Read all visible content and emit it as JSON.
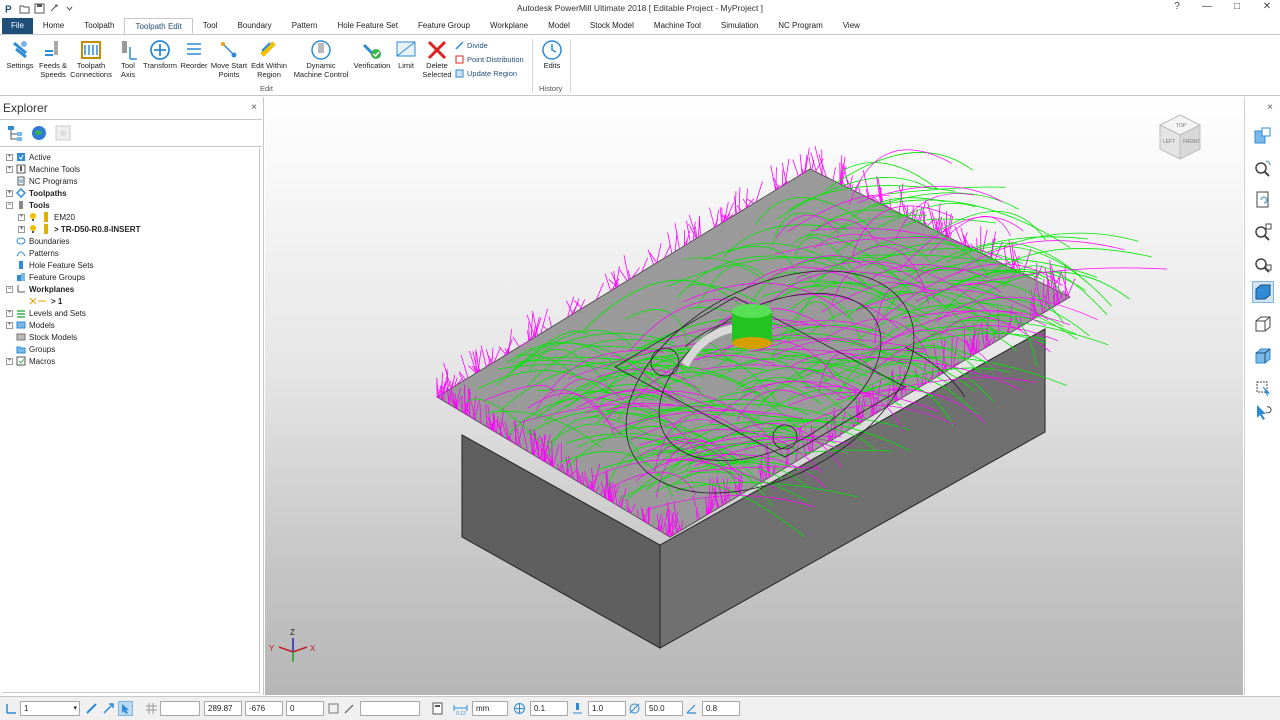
{
  "window": {
    "title": "Autodesk PowerMill Ultimate 2018   [ Editable Project - MyProject ]",
    "help": "?",
    "minimize": "—",
    "maximize": "□",
    "close": "✕"
  },
  "tabs": [
    {
      "label": "File"
    },
    {
      "label": "Home"
    },
    {
      "label": "Toolpath"
    },
    {
      "label": "Toolpath Edit"
    },
    {
      "label": "Tool"
    },
    {
      "label": "Boundary"
    },
    {
      "label": "Pattern"
    },
    {
      "label": "Hole Feature Set"
    },
    {
      "label": "Feature Group"
    },
    {
      "label": "Workplane"
    },
    {
      "label": "Model"
    },
    {
      "label": "Stock Model"
    },
    {
      "label": "Machine Tool"
    },
    {
      "label": "Simulation"
    },
    {
      "label": "NC Program"
    },
    {
      "label": "View"
    }
  ],
  "ribbon": {
    "settings": "Settings",
    "feeds": "Feeds &\nSpeeds",
    "connections": "Toolpath\nConnections",
    "tool_axis": "Tool\nAxis",
    "transform": "Transform",
    "reorder": "Reorder",
    "move_start": "Move Start\nPoints",
    "edit_within": "Edit Within\nRegion",
    "dynamic": "Dynamic\nMachine Control",
    "verification": "Verification",
    "limit": "Limit",
    "delete_selected": "Delete\nSelected",
    "divide": "Divide",
    "point_distribution": "Point Distribution",
    "update_region": "Update Region",
    "edits": "Edits",
    "group_edit": "Edit",
    "group_history": "History"
  },
  "explorer": {
    "title": "Explorer",
    "close": "×",
    "items": [
      {
        "label": "Active",
        "bold": false
      },
      {
        "label": "Machine Tools",
        "bold": false
      },
      {
        "label": "NC Programs",
        "bold": false
      },
      {
        "label": "Toolpaths",
        "bold": true
      },
      {
        "label": "Tools",
        "bold": true
      },
      {
        "label": "EM20",
        "bold": false
      },
      {
        "label": "> TR-D50-R0.8-INSERT",
        "bold": true
      },
      {
        "label": "Boundaries",
        "bold": false
      },
      {
        "label": "Patterns",
        "bold": false
      },
      {
        "label": "Hole Feature Sets",
        "bold": false
      },
      {
        "label": "Feature Groups",
        "bold": false
      },
      {
        "label": "Workplanes",
        "bold": true
      },
      {
        "label": "> 1",
        "bold": true
      },
      {
        "label": "Levels and Sets",
        "bold": false
      },
      {
        "label": "Models",
        "bold": false
      },
      {
        "label": "Stock Models",
        "bold": false
      },
      {
        "label": "Groups",
        "bold": false
      },
      {
        "label": "Macros",
        "bold": false
      }
    ]
  },
  "viewcube": {
    "top": "TOP",
    "left": "LEFT",
    "front": "FRONT"
  },
  "axes": {
    "x": "X",
    "y": "Y",
    "z": "Z"
  },
  "status": {
    "workplane": "1",
    "x": "289.87",
    "y": "-676",
    "z": "0",
    "units": "mm",
    "tolerance": "0.1",
    "stepover": "1.0",
    "diameter": "50.0",
    "angle": "0.8"
  },
  "colors": {
    "accent": "#1f4e79",
    "toolpath_green": "#00e600",
    "toolpath_magenta": "#ff00ff",
    "block_gray": "#6a6a6a"
  }
}
